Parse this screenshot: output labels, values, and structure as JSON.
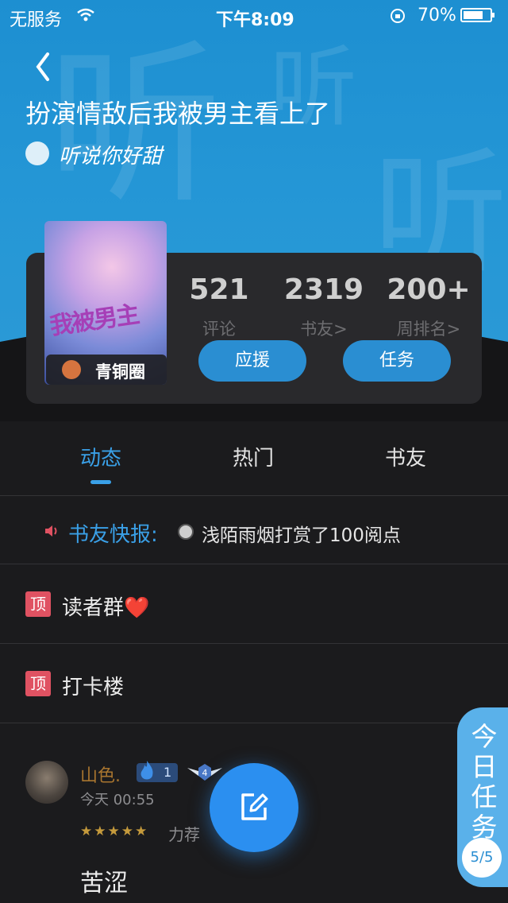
{
  "status_bar": {
    "carrier": "无服务",
    "time": "下午8:09",
    "battery": "70%"
  },
  "header": {
    "watermark": "听",
    "book_title": "扮演情敌后我被男主看上了",
    "author": "听说你好甜"
  },
  "book": {
    "cover_text": "我被男主",
    "tier_label": "青铜圈",
    "stats": [
      {
        "value": "521",
        "label": "评论"
      },
      {
        "value": "2319",
        "label": "书友>"
      },
      {
        "value": "200+",
        "label": "周排名>"
      }
    ],
    "actions": [
      "应援",
      "任务"
    ]
  },
  "tabs": [
    {
      "label": "动态",
      "active": true
    },
    {
      "label": "热门",
      "active": false
    },
    {
      "label": "书友",
      "active": false
    }
  ],
  "news": {
    "label": "书友快报:",
    "text": "浅陌雨烟打赏了100阅点"
  },
  "pinned": [
    {
      "badge": "顶",
      "text": "读者群❤️"
    },
    {
      "badge": "顶",
      "text": "打卡楼"
    }
  ],
  "post": {
    "username": "山色.",
    "level": "1",
    "badge_number": "4",
    "time": "今天 00:55",
    "stars": "★★★★★",
    "tag": "力荐",
    "content": "苦涩"
  },
  "today_task": {
    "label": "今日任务",
    "progress": "5/5"
  },
  "colors": {
    "accent": "#3aa0e7",
    "header_blue": "#1d8fd1",
    "pin_red": "#e05262",
    "background": "#1b1b1d"
  }
}
